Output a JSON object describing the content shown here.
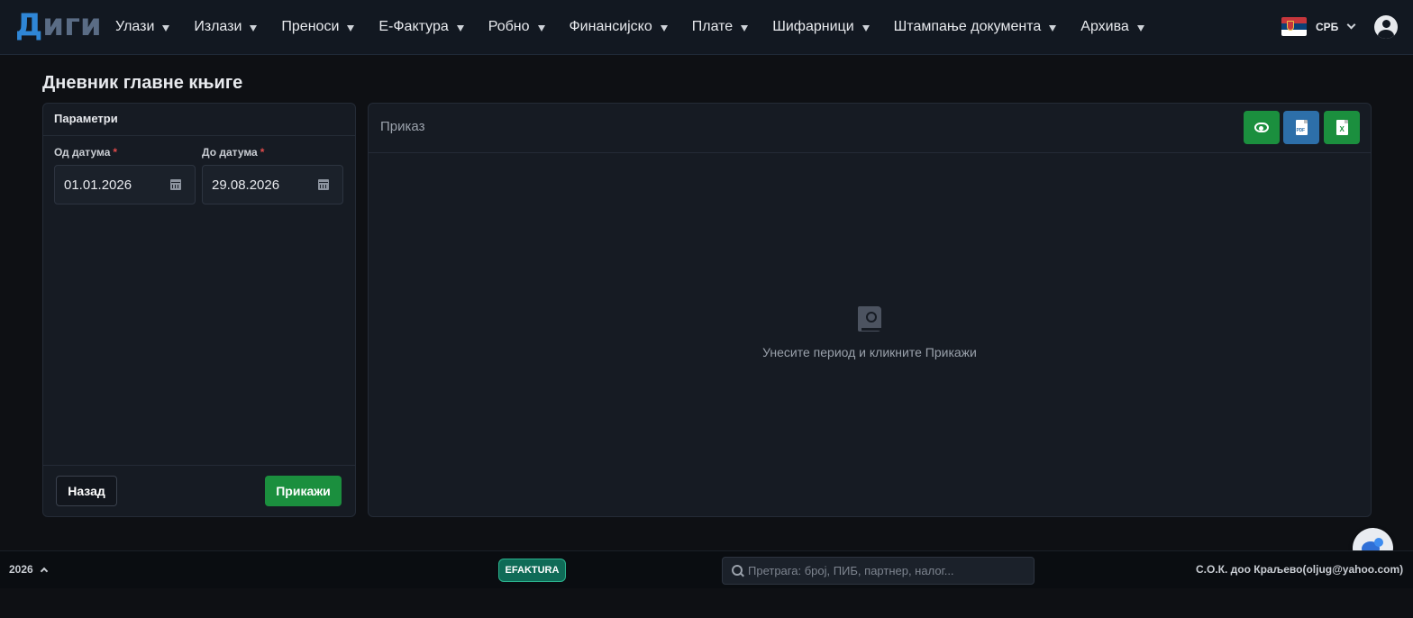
{
  "app": {
    "brand_part1": "Д",
    "brand_part2": "иги"
  },
  "nav": {
    "items": [
      {
        "label": "Улази"
      },
      {
        "label": "Излази"
      },
      {
        "label": "Преноси"
      },
      {
        "label": "Е-Фактура"
      },
      {
        "label": "Робно"
      },
      {
        "label": "Финансијско"
      },
      {
        "label": "Плате"
      },
      {
        "label": "Шифарници"
      },
      {
        "label": "Штампање документа"
      },
      {
        "label": "Архива"
      }
    ],
    "language": "СРБ",
    "flag_icon": "serbia-flag-icon",
    "user_icon": "user-circle-icon"
  },
  "page": {
    "title": "Дневник главне књиге"
  },
  "params": {
    "header": "Параметри",
    "from_label": "Од датума",
    "to_label": "До датума",
    "required_mark": "*",
    "from_value": "01.01.2026",
    "to_value": "29.08.2026",
    "back_label": "Назад",
    "show_label": "Прикажи"
  },
  "display": {
    "title": "Приказ",
    "empty_text": "Унесите период и кликните Прикажи",
    "actions": [
      "eye-icon",
      "pdf-file-icon",
      "excel-file-icon"
    ],
    "pdf_glyph": "PDF",
    "xls_glyph": "X"
  },
  "footer": {
    "year": "2026",
    "efaktura_badge": "EFAKTURA",
    "search_placeholder": "Претрага: број, ПИБ, партнер, налог...",
    "company": "С.О.К. доо Краљево(oljug@yahoo.com)"
  },
  "colors": {
    "primary_green": "#1b8f3e",
    "pdf_blue": "#2d6fa9",
    "brand_blue": "#2f86d6",
    "efaktura_teal": "#0f6b57",
    "background": "#0e1014"
  }
}
